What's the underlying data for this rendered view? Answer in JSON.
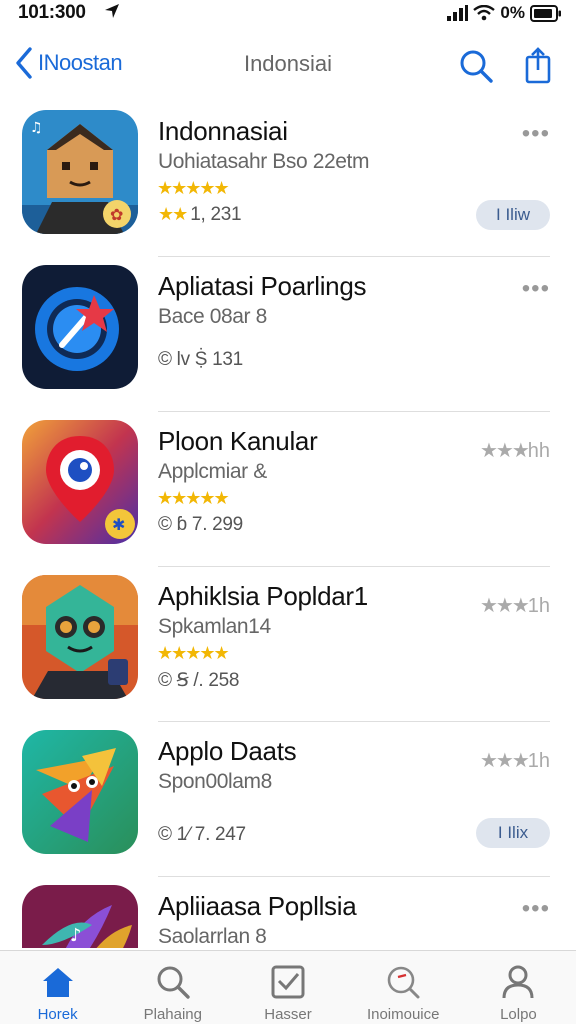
{
  "status_bar": {
    "time": "101:300",
    "battery_text": "0%"
  },
  "nav": {
    "back_label": "INoostan",
    "title": "Indonsiai"
  },
  "apps": [
    {
      "name": "Indonnasiai",
      "subtitle": "Uohiatasahr Bso 22etm",
      "stars": "★★★★★",
      "meta": "1, 231",
      "meta_stars": "★★",
      "more": "•••",
      "button": "I Iliw"
    },
    {
      "name": "Apliatasi Poarlings",
      "subtitle": "Bace 08ar 8",
      "meta": "© lv Ṩ 131",
      "more": "•••"
    },
    {
      "name": "Ploon Kanular",
      "subtitle": "Applcmiar &",
      "stars": "★★★★★",
      "meta": "© ɓ 7. 299",
      "rating_right": "★★★",
      "rating_right_suffix": "hh"
    },
    {
      "name": "Aphiklsia Popldar1",
      "subtitle": "Spkamlan14",
      "stars": "★★★★★",
      "meta": "© Ꞩ /. 258",
      "rating_right": "★★★",
      "rating_right_suffix": "1h"
    },
    {
      "name": "Applo Daats",
      "subtitle": "Spon00lam8",
      "meta": "© 1⁄ 7. 247",
      "rating_right": "★★★",
      "rating_right_suffix": "1h",
      "button": "I Ilix"
    },
    {
      "name": "Apliiaasa Popllsia",
      "subtitle": "Saolarrlan 8",
      "more": "•••"
    }
  ],
  "tabs": [
    {
      "label": "Horek",
      "icon": "home-icon",
      "active": true
    },
    {
      "label": "Plahaing",
      "icon": "search-icon"
    },
    {
      "label": "Hasser",
      "icon": "checkbox-icon"
    },
    {
      "label": "Inoimouice",
      "icon": "search-red-icon"
    },
    {
      "label": "Lolpo",
      "icon": "person-icon"
    }
  ],
  "colors": {
    "accent": "#1a6ad8",
    "star": "#f2b705"
  }
}
